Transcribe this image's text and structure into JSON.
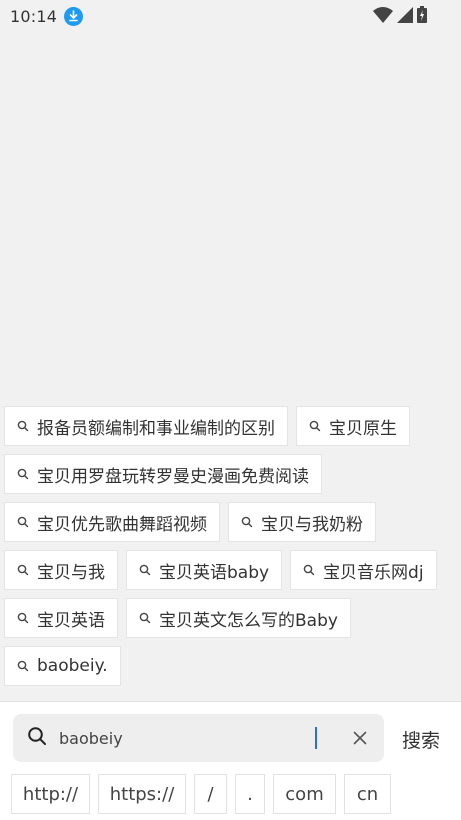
{
  "status_bar": {
    "time": "10:14",
    "icons": [
      "download-icon",
      "wifi-icon",
      "signal-icon",
      "battery-charging-icon"
    ]
  },
  "suggestions": [
    "报备员额编制和事业编制的区别",
    "宝贝原生",
    "宝贝用罗盘玩转罗曼史漫画免费阅读",
    "宝贝优先歌曲舞蹈视频",
    "宝贝与我奶粉",
    "宝贝与我",
    "宝贝英语baby",
    "宝贝音乐网dj",
    "宝贝英语",
    "宝贝英文怎么写的Baby",
    "baobeiy."
  ],
  "search": {
    "value": "baobeiy",
    "button_label": "搜索"
  },
  "shortcuts": [
    "http://",
    "https://",
    "/",
    ".",
    "com",
    "cn"
  ],
  "colors": {
    "accent": "#1e9bf0",
    "cursor": "#2f6dd6",
    "background": "#f1f1f1"
  }
}
